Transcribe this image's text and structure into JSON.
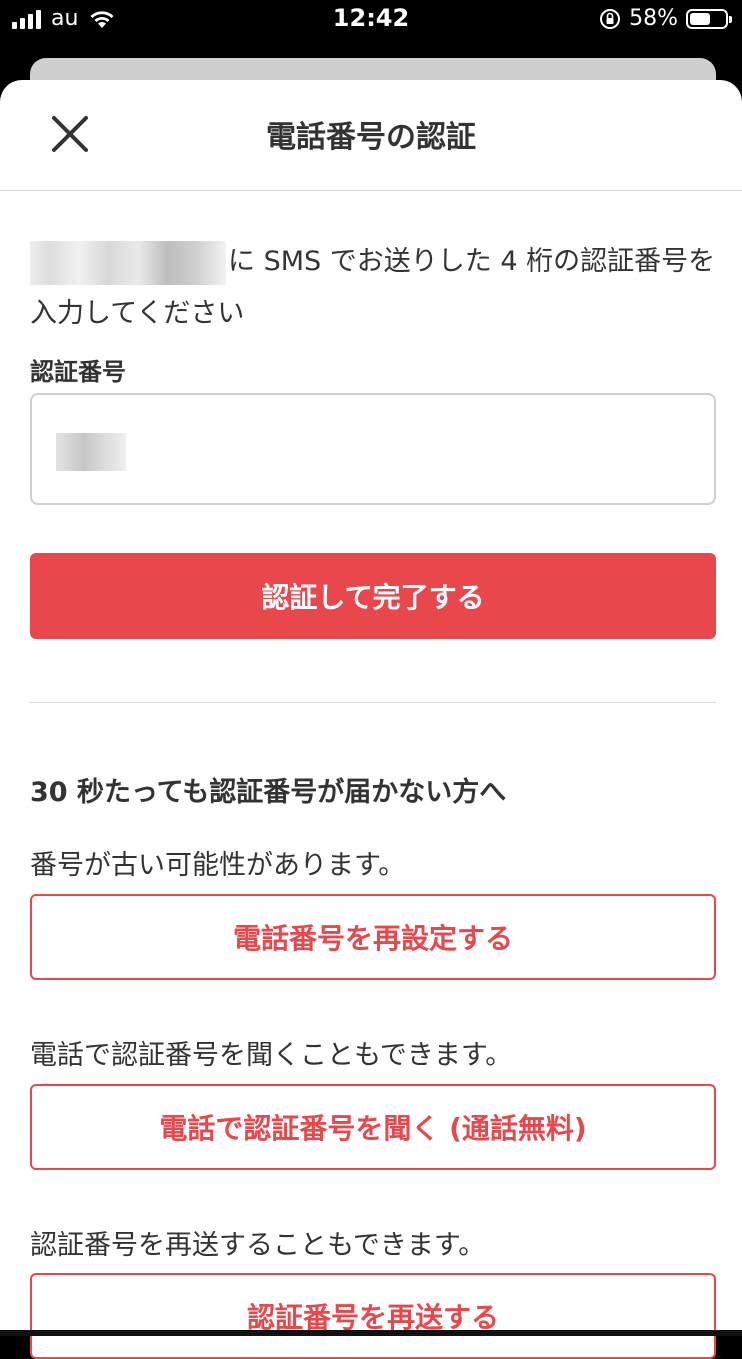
{
  "status_bar": {
    "carrier": "au",
    "time": "12:42",
    "battery_percent": "58%",
    "battery_level": 0.58
  },
  "header": {
    "title": "電話番号の認証",
    "close_icon": "close-icon"
  },
  "intro": {
    "text_after_phone": "に SMS でお送りした 4 桁の認証番号を入力してください"
  },
  "code_field": {
    "label": "認証番号"
  },
  "primary_button": {
    "label": "認証して完了する"
  },
  "help": {
    "heading": "30 秒たっても認証番号が届かない方へ",
    "reset": {
      "text": "番号が古い可能性があります。",
      "button": "電話番号を再設定する"
    },
    "call": {
      "text": "電話で認証番号を聞くこともできます。",
      "button": "電話で認証番号を聞く (通話無料)"
    },
    "resend": {
      "text": "認証番号を再送することもできます。",
      "button": "認証番号を再送する"
    }
  }
}
